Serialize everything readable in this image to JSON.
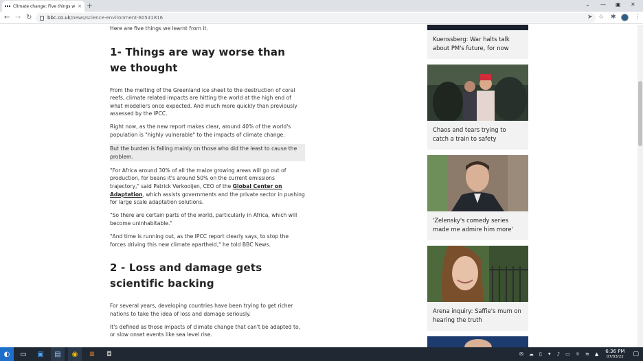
{
  "browser": {
    "tab_title": "Climate change: Five things w",
    "url_host": "bbc.co.uk",
    "url_path": "/news/science-environment-60541816",
    "new_tab": "+",
    "close_tab": "×",
    "back": "←",
    "forward": "→",
    "reload": "↻",
    "window_controls": [
      "⌄",
      "—",
      "▣",
      "✕"
    ]
  },
  "article": {
    "intro": "Here are five things we learnt from it.",
    "heading1": "1- Things are way worse than we thought",
    "p1": "From the melting of the Greenland ice sheet to the destruction of coral reefs, climate related impacts are hitting the world at the high end of what modellers once expected. And much more quickly than previously assessed by the IPCC.",
    "p2": "Right now, as the new report makes clear, around 40% of the world's population is \"highly vulnerable\" to the impacts of climate change.",
    "p3_highlighted": "But the burden is falling mainly on those who did the least to cause the problem.",
    "p4_before": "\"For Africa around 30% of all the maize growing areas will go out of production, for beans it's around 50% on the current emissions trajectory,\" said Patrick Verkooijen, CEO of the ",
    "p4_link": "Global Center on Adaptation",
    "p4_after": ", which assists governments and the private sector in pushing for large scale adaptation solutions.",
    "p5": "\"So there are certain parts of the world, particularly in Africa, which will become uninhabitable.\"",
    "p6": "\"And time is running out, as the IPCC report clearly says, to stop the forces driving this new climate apartheid,\" he told BBC News.",
    "heading2": "2 - Loss and damage gets scientific backing",
    "p7": "For several years, developing countries have been trying to get richer nations to take the idea of loss and damage seriously.",
    "p8": "It's defined as those impacts of climate change that can't be adapted to, or slow onset events like sea level rise."
  },
  "sidebar": {
    "cards": [
      {
        "caption": "Kuenssberg: War halts talk about PM's future, for now"
      },
      {
        "caption": "Chaos and tears trying to catch a train to safety"
      },
      {
        "caption": "'Zelensky's comedy series made me admire him more'"
      },
      {
        "caption": "Arena inquiry: Saffie's mum on hearing the truth"
      }
    ]
  },
  "taskbar": {
    "time": "6:36 PM",
    "date": "07/03/22"
  },
  "colors": {
    "highlight_bg": "#ebebeb",
    "card_bg": "#f2f2f2",
    "taskbar_bg": "#1f2833"
  }
}
